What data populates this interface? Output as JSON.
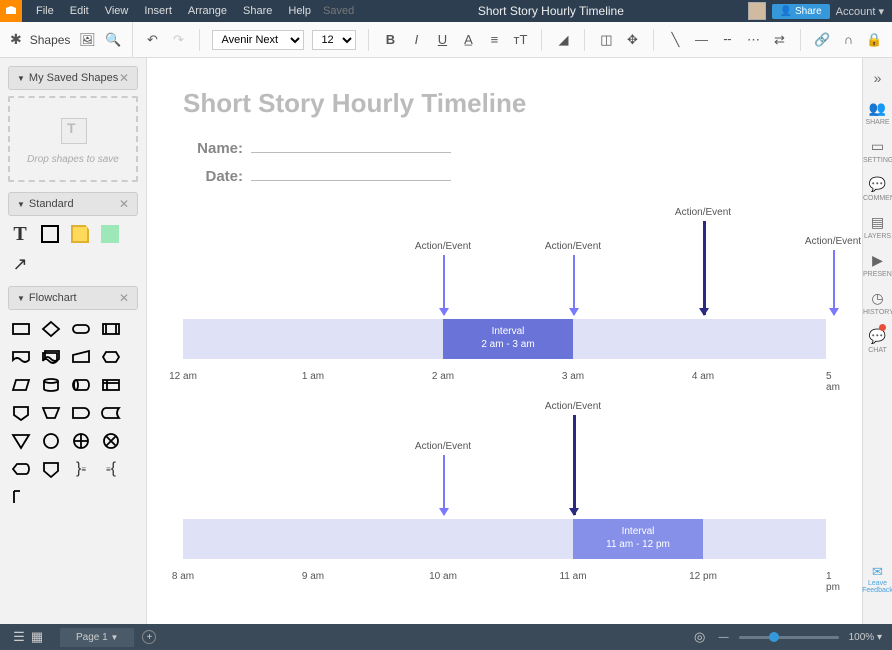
{
  "menu": {
    "items": [
      "File",
      "Edit",
      "View",
      "Insert",
      "Arrange",
      "Share",
      "Help"
    ],
    "saved": "Saved",
    "title": "Short Story Hourly Timeline",
    "share": "Share",
    "account": "Account ▾"
  },
  "toolbar": {
    "shapes_label": "Shapes",
    "font": "Avenir Next",
    "size": "12 pt"
  },
  "panels": {
    "saved": {
      "title": "My Saved Shapes",
      "drop_hint": "Drop shapes to save"
    },
    "standard": {
      "title": "Standard"
    },
    "flowchart": {
      "title": "Flowchart"
    }
  },
  "doc": {
    "title": "Short Story Hourly Timeline",
    "name_label": "Name:",
    "date_label": "Date:"
  },
  "timeline1": {
    "hours": [
      "12 am",
      "1 am",
      "2 am",
      "3 am",
      "4 am",
      "5 am"
    ],
    "events": [
      {
        "label": "Action/Event",
        "hour": 2,
        "style": "light",
        "yoff": 0
      },
      {
        "label": "Action/Event",
        "hour": 3,
        "style": "light",
        "yoff": 0
      },
      {
        "label": "Action/Event",
        "hour": 4,
        "style": "dark",
        "yoff": -34
      },
      {
        "label": "Action/Event",
        "hour": 5,
        "style": "light",
        "yoff": -5
      }
    ],
    "interval": {
      "label": "Interval",
      "range": "2 am - 3 am",
      "start": 2,
      "end": 3
    }
  },
  "timeline2": {
    "hours": [
      "8 am",
      "9 am",
      "10 am",
      "11 am",
      "12 pm",
      "1 pm"
    ],
    "events": [
      {
        "label": "Action/Event",
        "hour": 2,
        "style": "light",
        "yoff": 0
      },
      {
        "label": "Action/Event",
        "hour": 3,
        "style": "dark",
        "yoff": -40
      }
    ],
    "interval": {
      "label": "Interval",
      "range": "11 am - 12 pm",
      "start": 3,
      "end": 4,
      "light": true
    }
  },
  "rightbar": {
    "items": [
      {
        "icon": "»",
        "label": ""
      },
      {
        "icon": "👥",
        "label": "SHARE"
      },
      {
        "icon": "▭",
        "label": "SETTINGS"
      },
      {
        "icon": "💬",
        "label": "COMMENT"
      },
      {
        "icon": "▤",
        "label": "LAYERS"
      },
      {
        "icon": "▶",
        "label": "PRESENT"
      },
      {
        "icon": "◷",
        "label": "HISTORY"
      },
      {
        "icon": "💬",
        "label": "CHAT",
        "badge": true
      }
    ],
    "feedback": {
      "icon": "✉",
      "label": "Leave Feedback"
    }
  },
  "bottombar": {
    "page": "Page 1",
    "zoom": "100% ▾"
  }
}
